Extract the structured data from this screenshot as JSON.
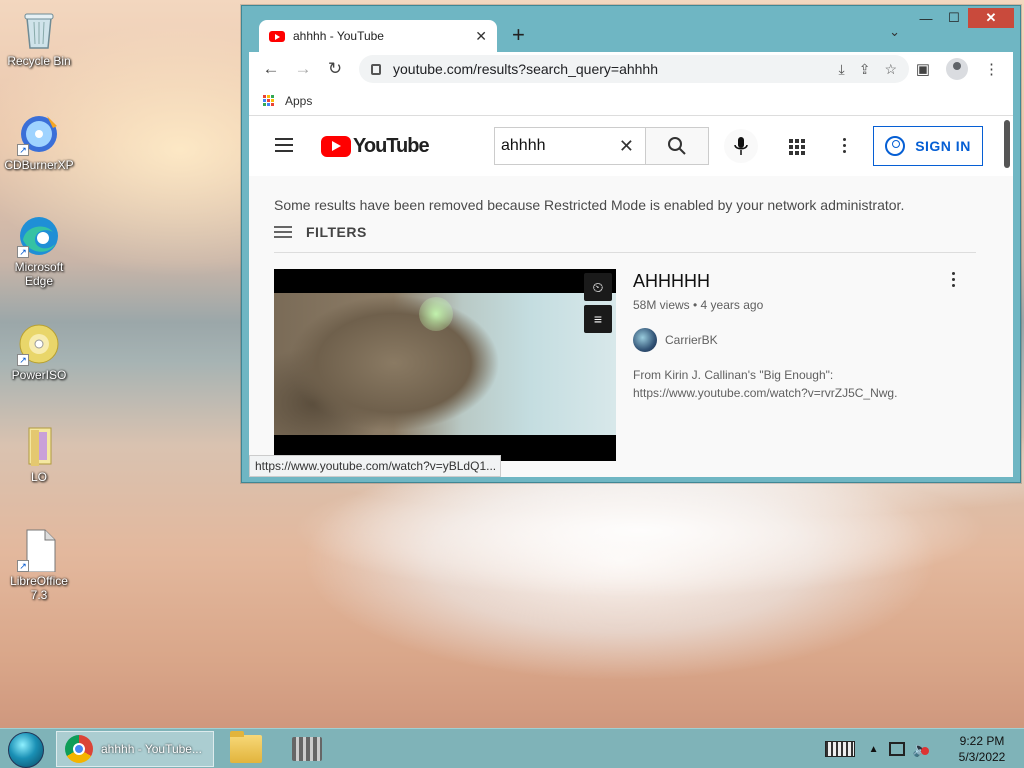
{
  "desktop": {
    "icons": [
      {
        "label": "Recycle Bin",
        "icon": "recycle-bin-icon"
      },
      {
        "label": "CDBurnerXP",
        "icon": "cd-burner-icon"
      },
      {
        "label": "Microsoft Edge",
        "icon": "edge-icon"
      },
      {
        "label": "PowerISO",
        "icon": "disc-icon"
      },
      {
        "label": "LO",
        "icon": "folder-icon"
      },
      {
        "label": "LibreOffice 7.3",
        "icon": "document-icon"
      }
    ]
  },
  "browser": {
    "tab_title": "ahhhh - YouTube",
    "url": "youtube.com/results?search_query=ahhhh",
    "bookmarks_label": "Apps",
    "status_url": "https://www.youtube.com/watch?v=yBLdQ1..."
  },
  "youtube": {
    "logo_text": "YouTube",
    "search_value": "ahhhh",
    "sign_in_label": "SIGN IN",
    "restricted_notice": "Some results have been removed because Restricted Mode is enabled by your network administrator.",
    "filters_label": "FILTERS",
    "result": {
      "title": "AHHHHH",
      "meta": "58M views • 4 years ago",
      "channel": "CarrierBK",
      "description_line1": "From Kirin J. Callinan's \"Big Enough\":",
      "description_line2": "https://www.youtube.com/watch?v=rvrZJ5C_Nwg."
    }
  },
  "taskbar": {
    "chrome_task_label": "ahhhh - YouTube...",
    "time": "9:22 PM",
    "date": "5/3/2022"
  }
}
